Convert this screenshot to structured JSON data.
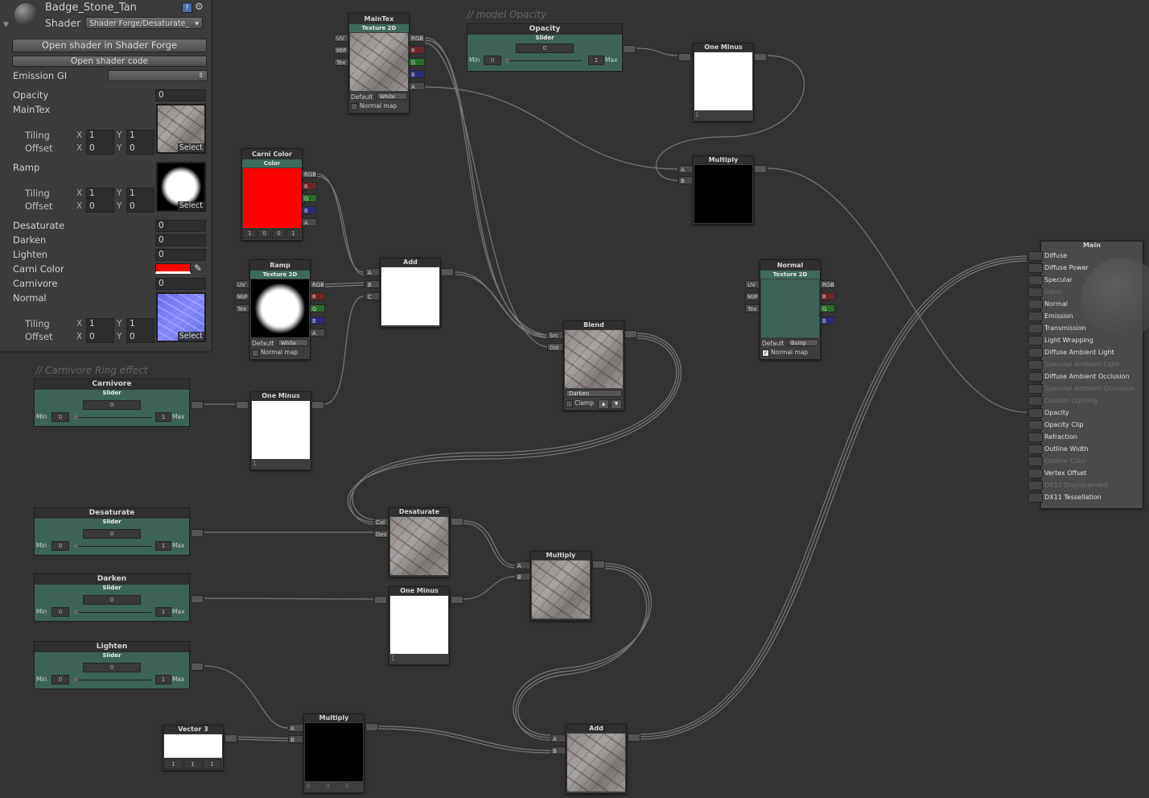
{
  "inspector": {
    "material_name": "Badge_Stone_Tan",
    "shader_label": "Shader",
    "shader_value": "Shader Forge/Desaturate_",
    "open_shader_button": "Open shader in Shader Forge",
    "open_code_button": "Open shader code",
    "emission_gi_label": "Emission GI",
    "opacity_label": "Opacity",
    "opacity_value": "0",
    "maintex_label": "MainTex",
    "tiling_label": "Tiling",
    "offset_label": "Offset",
    "x_label": "X",
    "y_label": "Y",
    "one": "1",
    "zero": "0",
    "select_label": "Select",
    "ramp_label": "Ramp",
    "desaturate_label": "Desaturate",
    "desaturate_value": "0",
    "darken_label": "Darken",
    "darken_value": "0",
    "lighten_label": "Lighten",
    "lighten_value": "0",
    "carni_color_label": "Carni Color",
    "carnivore_label": "Carnivore",
    "carnivore_value": "0",
    "normal_label": "Normal"
  },
  "comments": {
    "model_opacity": "// model Opacity",
    "carnivore_ring": "// Carnivore Ring effect"
  },
  "ports": {
    "uv": "UV",
    "mip": "MIP",
    "tex": "Tex",
    "rgb": "RGB",
    "r": "R",
    "g": "G",
    "b": "B",
    "a": "A",
    "in_a": "A",
    "in_b": "B",
    "in_c": "C",
    "src": "Src",
    "dst": "Dst",
    "col": "Col",
    "des": "Des"
  },
  "nodes": {
    "maintex": {
      "title": "MainTex",
      "sub": "Texture 2D",
      "default_label": "Default",
      "default_value": "White",
      "normal_map": "Normal map"
    },
    "opacity": {
      "title": "Opacity",
      "sub": "Slider",
      "value": "0",
      "min_label": "Min",
      "min": "0",
      "max": "1",
      "max_label": "Max"
    },
    "one_minus_top": {
      "title": "One Minus",
      "footer": "1"
    },
    "multiply_top": {
      "title": "Multiply"
    },
    "carni_color": {
      "title": "Carni Color",
      "sub": "Color",
      "values": [
        "1",
        "0",
        "0",
        "1"
      ]
    },
    "ramp": {
      "title": "Ramp",
      "sub": "Texture 2D",
      "default_label": "Default",
      "default_value": "White",
      "normal_map": "Normal map"
    },
    "add_top": {
      "title": "Add"
    },
    "blend": {
      "title": "Blend",
      "mode": "Darken",
      "clamp": "Clamp"
    },
    "normal": {
      "title": "Normal",
      "sub": "Texture 2D",
      "default_label": "Default",
      "default_value": "Bump",
      "normal_map": "Normal map"
    },
    "carnivore": {
      "title": "Carnivore",
      "sub": "Slider",
      "value": "0",
      "min_label": "Min",
      "min": "0",
      "max": "1",
      "max_label": "Max"
    },
    "one_minus_mid": {
      "title": "One Minus",
      "footer": "1"
    },
    "desaturate_slider": {
      "title": "Desaturate",
      "sub": "Slider",
      "value": "0",
      "min_label": "Min",
      "min": "0",
      "max": "1",
      "max_label": "Max"
    },
    "desaturate_node": {
      "title": "Desaturate"
    },
    "darken_slider": {
      "title": "Darken",
      "sub": "Slider",
      "value": "0",
      "min_label": "Min",
      "min": "0",
      "max": "1",
      "max_label": "Max"
    },
    "one_minus_low": {
      "title": "One Minus",
      "footer": "1"
    },
    "multiply_mid": {
      "title": "Multiply"
    },
    "lighten_slider": {
      "title": "Lighten",
      "sub": "Slider",
      "value": "0",
      "min_label": "Min",
      "min": "0",
      "max": "1",
      "max_label": "Max"
    },
    "vector3": {
      "title": "Vector 3",
      "values": [
        "1",
        "1",
        "1"
      ]
    },
    "multiply_bottom": {
      "title": "Multiply",
      "values": [
        "0",
        "0",
        "0"
      ]
    },
    "add_bottom": {
      "title": "Add"
    }
  },
  "main_node": {
    "title": "Main",
    "inputs": [
      {
        "label": "Diffuse",
        "enabled": true
      },
      {
        "label": "Diffuse Power",
        "enabled": true
      },
      {
        "label": "Specular",
        "enabled": true
      },
      {
        "label": "Gloss",
        "enabled": false
      },
      {
        "label": "Normal",
        "enabled": true
      },
      {
        "label": "Emission",
        "enabled": true
      },
      {
        "label": "Transmission",
        "enabled": true
      },
      {
        "label": "Light Wrapping",
        "enabled": true
      },
      {
        "label": "Diffuse Ambient Light",
        "enabled": true
      },
      {
        "label": "Specular Ambient Light",
        "enabled": false
      },
      {
        "label": "Diffuse Ambient Occlusion",
        "enabled": true
      },
      {
        "label": "Specular Ambient Occlusion",
        "enabled": false
      },
      {
        "label": "Custom Lighting",
        "enabled": false
      },
      {
        "label": "Opacity",
        "enabled": true
      },
      {
        "label": "Opacity Clip",
        "enabled": true
      },
      {
        "label": "Refraction",
        "enabled": true
      },
      {
        "label": "Outline Width",
        "enabled": true
      },
      {
        "label": "Outline Color",
        "enabled": false
      },
      {
        "label": "Vertex Offset",
        "enabled": true
      },
      {
        "label": "DX11 Displacement",
        "enabled": false
      },
      {
        "label": "DX11 Tessellation",
        "enabled": true
      }
    ]
  },
  "colors": {
    "canvas": "#333333",
    "node_header_teal": "#3f6a5a",
    "carni_color_swatch": "#ff0000",
    "port_r": "#6b2727",
    "port_g": "#2b6b2b",
    "port_b": "#2a2d73"
  }
}
